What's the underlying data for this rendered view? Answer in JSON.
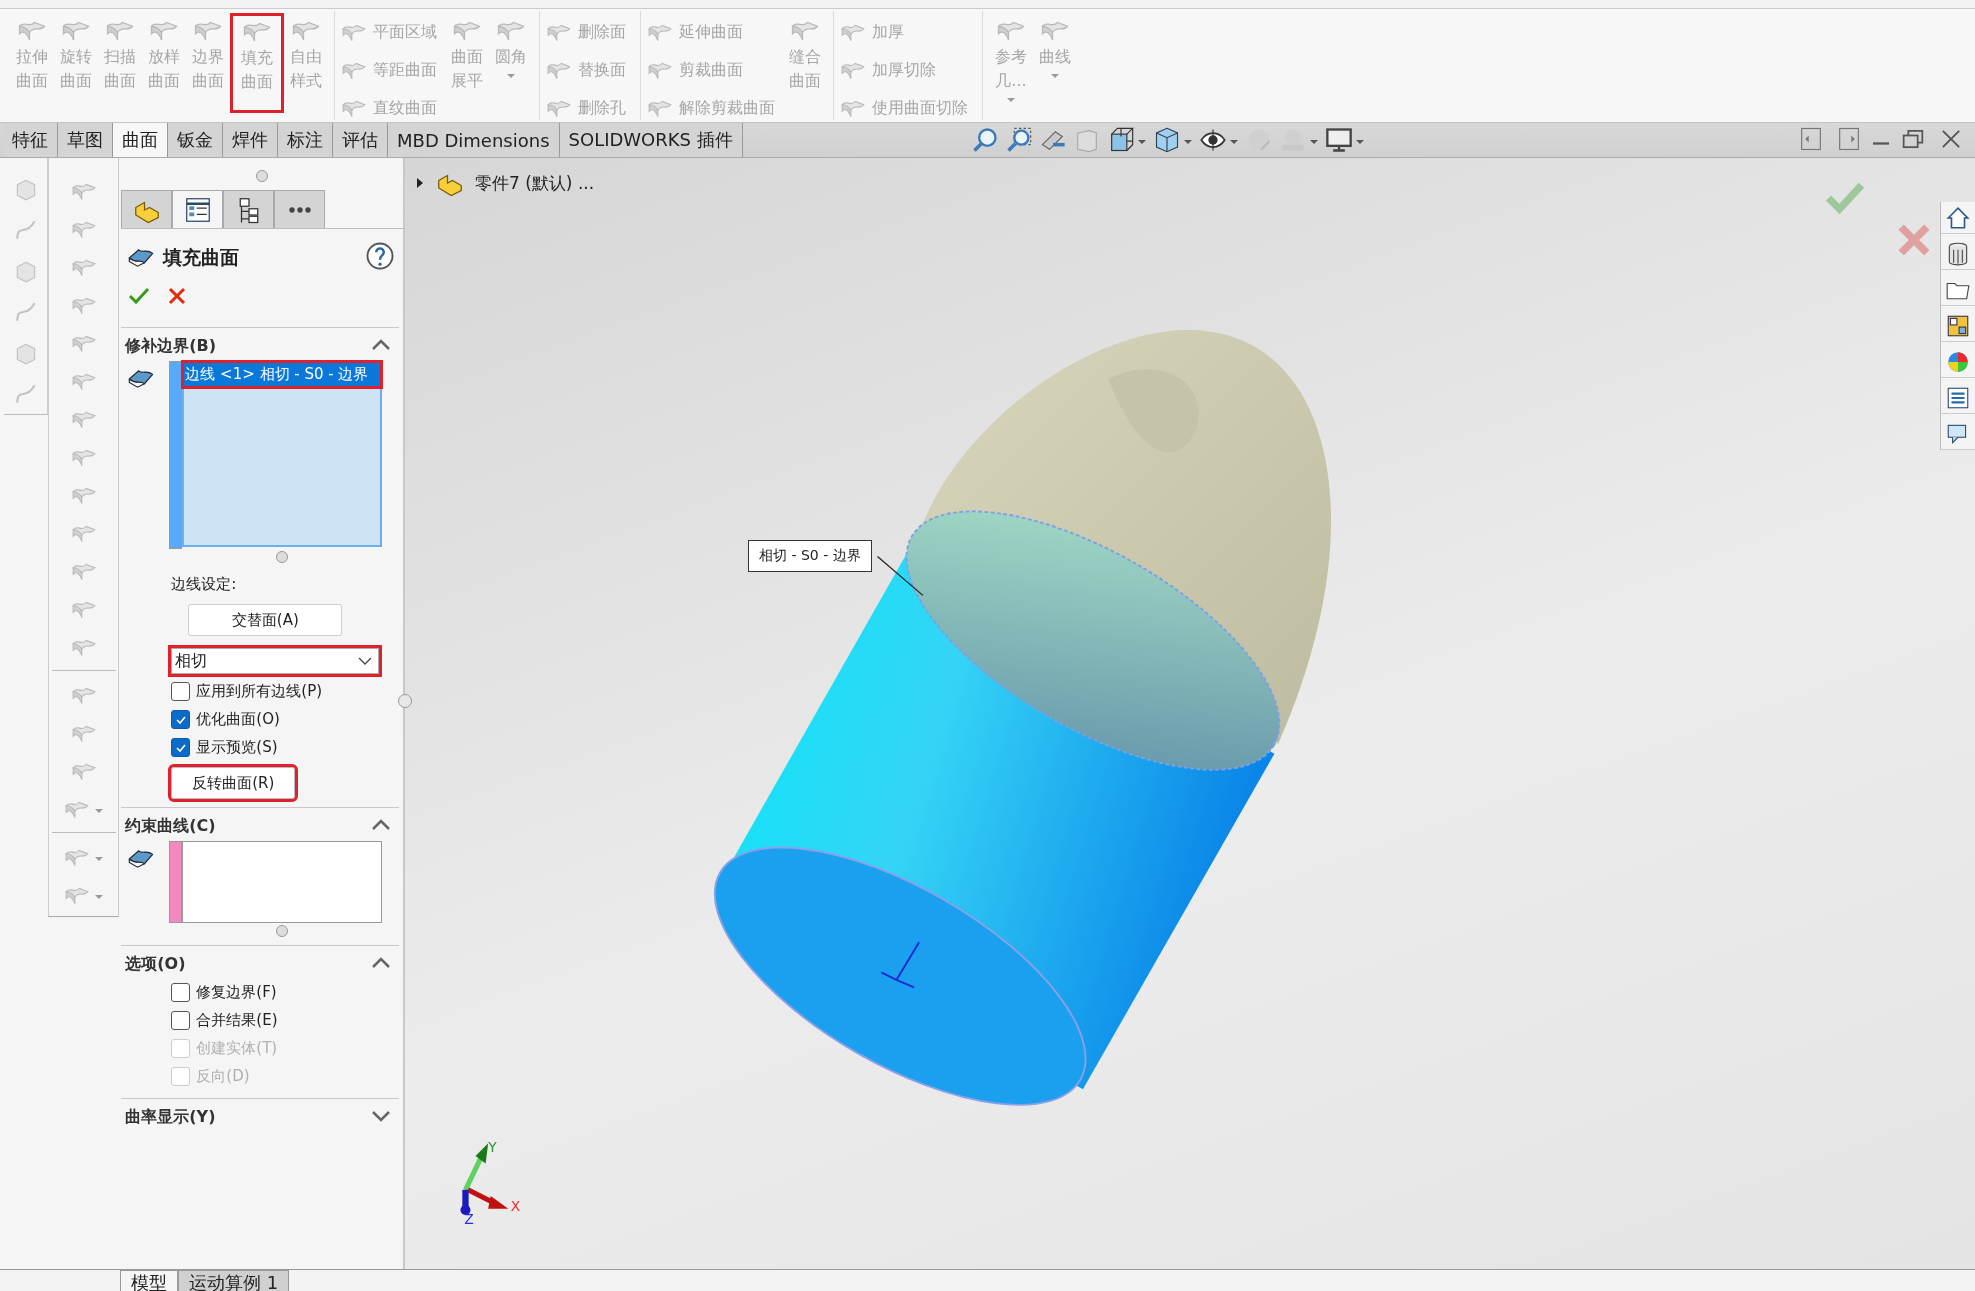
{
  "ribbon": {
    "groups": [
      {
        "items": [
          {
            "kind": "large",
            "label": "拉伸曲面",
            "disabled": true,
            "highlighted": false,
            "dropdown": false
          },
          {
            "kind": "large",
            "label": "旋转曲面",
            "disabled": true,
            "highlighted": false,
            "dropdown": false
          },
          {
            "kind": "large",
            "label": "扫描曲面",
            "disabled": true,
            "highlighted": false,
            "dropdown": false
          },
          {
            "kind": "large",
            "label": "放样曲面",
            "disabled": true,
            "highlighted": false,
            "dropdown": false
          },
          {
            "kind": "large",
            "label": "边界曲面",
            "disabled": true,
            "highlighted": false,
            "dropdown": false
          },
          {
            "kind": "large",
            "label": "填充曲面",
            "disabled": true,
            "highlighted": true,
            "dropdown": false
          },
          {
            "kind": "large",
            "label": "自由样式",
            "disabled": true,
            "highlighted": false,
            "dropdown": false
          }
        ]
      },
      {
        "items": [
          {
            "kind": "stack",
            "buttons": [
              {
                "label": "平面区域",
                "disabled": true
              },
              {
                "label": "等距曲面",
                "disabled": true
              },
              {
                "label": "直纹曲面",
                "disabled": true
              }
            ]
          },
          {
            "kind": "large",
            "label": "曲面展平",
            "disabled": true,
            "highlighted": false,
            "dropdown": false
          },
          {
            "kind": "large",
            "label": "圆角",
            "disabled": true,
            "highlighted": false,
            "dropdown": true
          }
        ]
      },
      {
        "items": [
          {
            "kind": "stack",
            "buttons": [
              {
                "label": "删除面",
                "disabled": true
              },
              {
                "label": "替换面",
                "disabled": true
              },
              {
                "label": "删除孔",
                "disabled": true
              }
            ]
          }
        ]
      },
      {
        "items": [
          {
            "kind": "stack",
            "buttons": [
              {
                "label": "延伸曲面",
                "disabled": true
              },
              {
                "label": "剪裁曲面",
                "disabled": true
              },
              {
                "label": "解除剪裁曲面",
                "disabled": true
              }
            ]
          },
          {
            "kind": "large",
            "label": "缝合曲面",
            "disabled": true,
            "highlighted": false,
            "dropdown": false
          }
        ]
      },
      {
        "items": [
          {
            "kind": "stack",
            "buttons": [
              {
                "label": "加厚",
                "disabled": true
              },
              {
                "label": "加厚切除",
                "disabled": true
              },
              {
                "label": "使用曲面切除",
                "disabled": true
              }
            ]
          }
        ]
      },
      {
        "items": [
          {
            "kind": "large",
            "label": "参考几...",
            "disabled": true,
            "highlighted": false,
            "dropdown": true
          },
          {
            "kind": "large",
            "label": "曲线",
            "disabled": true,
            "highlighted": false,
            "dropdown": true
          }
        ]
      }
    ]
  },
  "command_tabs": [
    {
      "label": "特征",
      "selected": false
    },
    {
      "label": "草图",
      "selected": false
    },
    {
      "label": "曲面",
      "selected": true
    },
    {
      "label": "钣金",
      "selected": false
    },
    {
      "label": "焊件",
      "selected": false
    },
    {
      "label": "标注",
      "selected": false
    },
    {
      "label": "评估",
      "selected": false
    },
    {
      "label": "MBD Dimensions",
      "selected": false
    },
    {
      "label": "SOLIDWORKS 插件",
      "selected": false
    }
  ],
  "panel": {
    "tabs": [
      {
        "selected": false
      },
      {
        "selected": true
      },
      {
        "selected": false
      },
      {
        "selected": false
      }
    ],
    "title": "填充曲面",
    "sections": [
      {
        "kind": "boundary",
        "title": "修补边界(B)",
        "expanded": true,
        "items": [
          {
            "label": "边线 <1> 相切 - S0 - 边界",
            "selected": true,
            "highlighted": true
          }
        ],
        "edge_settings_label": "边线设定:",
        "alternate_button": "交替面(A)",
        "dropdown": {
          "value": "相切",
          "highlighted": true
        },
        "checkboxes": [
          {
            "label": "应用到所有边线(P)",
            "checked": false,
            "disabled": false
          },
          {
            "label": "优化曲面(O)",
            "checked": true,
            "disabled": false
          },
          {
            "label": "显示预览(S)",
            "checked": true,
            "disabled": false
          }
        ],
        "reverse_button": {
          "label": "反转曲面(R)",
          "highlighted": true
        }
      },
      {
        "kind": "constraint",
        "title": "约束曲线(C)",
        "expanded": true
      },
      {
        "kind": "options",
        "title": "选项(O)",
        "expanded": true,
        "checkboxes": [
          {
            "label": "修复边界(F)",
            "checked": false,
            "disabled": false
          },
          {
            "label": "合并结果(E)",
            "checked": false,
            "disabled": false
          },
          {
            "label": "创建实体(T)",
            "checked": false,
            "disabled": true
          },
          {
            "label": "反向(D)",
            "checked": false,
            "disabled": true
          }
        ]
      },
      {
        "kind": "curvature",
        "title": "曲率显示(Y)",
        "expanded": false
      }
    ]
  },
  "viewport": {
    "tree_label": "零件7 (默认) ...",
    "callout": "相切 - S0 - 边界",
    "triad": {
      "x_label": "X",
      "y_label": "Y",
      "z_label": "Z"
    }
  },
  "bottom_tabs": [
    {
      "label": "模型",
      "selected": true
    },
    {
      "label": "运动算例 1",
      "selected": false
    }
  ]
}
